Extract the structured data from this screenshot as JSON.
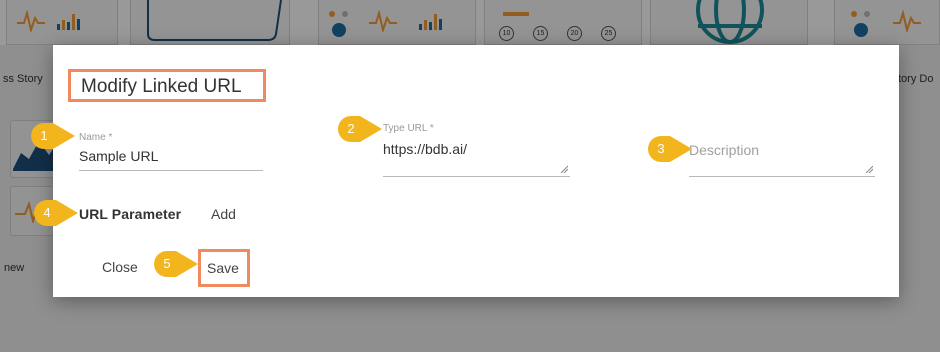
{
  "background": {
    "left_story_label": "ss Story",
    "right_story_label": "tory Do",
    "new_label": "new",
    "gauge_numbers": [
      "10",
      "15",
      "20",
      "25"
    ]
  },
  "modal": {
    "title": "Modify Linked URL",
    "name_field": {
      "label": "Name *",
      "value": "Sample URL"
    },
    "type_url_field": {
      "label": "Type URL *",
      "value": "https://bdb.ai/"
    },
    "description_field": {
      "placeholder": "Description"
    },
    "url_parameter_label": "URL Parameter",
    "add_label": "Add",
    "close_label": "Close",
    "save_label": "Save"
  },
  "callouts": [
    "1",
    "2",
    "3",
    "4",
    "5"
  ],
  "colors": {
    "callout": "#f3b51d",
    "highlight_border": "#ee8a5e",
    "chart_orange": "#f39c33",
    "chart_blue": "#1e6fa3",
    "globe_teal": "#1d8a99"
  }
}
